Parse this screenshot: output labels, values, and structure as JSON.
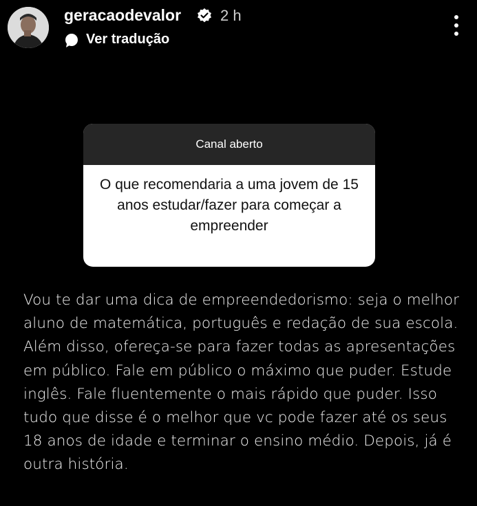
{
  "post": {
    "username": "geracaodevalor",
    "time_ago": "2 h",
    "verified_icon": "verified-badge-icon",
    "translate_label": "Ver tradução",
    "menu_icon": "more-vertical-icon"
  },
  "question_card": {
    "title": "Canal aberto",
    "question": "O que recomendaria a uma jovem de 15 anos estudar/fazer para começar a empreender"
  },
  "answer": {
    "text": "Vou te dar uma dica de empreendedorismo: seja o melhor aluno de matemática, português e redação de sua escola. Além disso, ofereça-se para fazer todas as apresentações em público. Fale em público o máximo que puder. Estude inglês. Fale fluentemente o mais rápido que puder. Isso tudo que disse é o melhor que vc pode fazer até os seus 18 anos de idade e terminar o ensino médio. Depois, já é outra história."
  },
  "colors": {
    "background": "#000000",
    "card_header": "#262626",
    "card_body": "#ffffff"
  }
}
